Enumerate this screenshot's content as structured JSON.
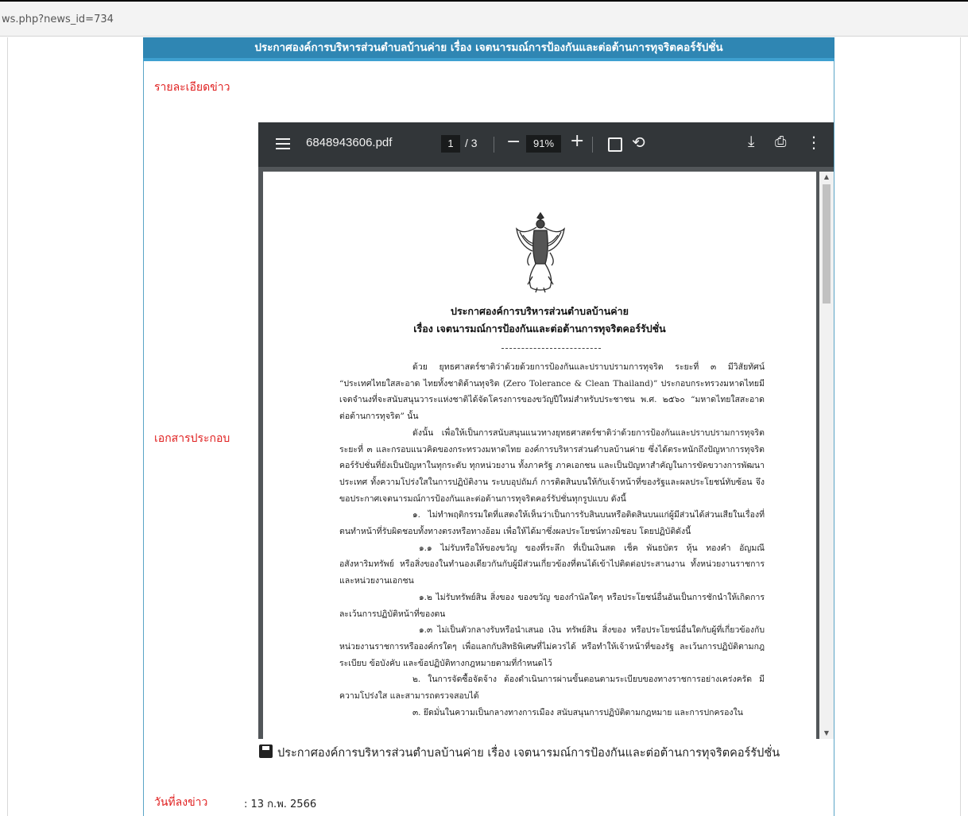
{
  "browser": {
    "url_fragment": "ws.php?news_id=734"
  },
  "news": {
    "header_title": "ประกาศองค์การบริหารส่วนตำบลบ้านค่าย เรื่อง เจตนารมณ์การป้องกันและต่อต้านการทุจริตคอร์รัปชั่น",
    "detail_label": "รายละเอียดข่าว",
    "attachment_label": "เอกสารประกอบ",
    "date_label": "วันที่ลงข่าว",
    "date_value": ": 13 ก.พ. 2566",
    "attachment_link": "ประกาศองค์การบริหารส่วนตำบลบ้านค่าย เรื่อง เจตนารมณ์การป้องกันและต่อต้านการทุจริตคอร์รัปชั่น"
  },
  "pdf_viewer": {
    "filename": "6848943606.pdf",
    "current_page": "1",
    "total_pages": "/ 3",
    "zoom": "91%",
    "minus_symbol": "−",
    "plus_symbol": "+",
    "icons": [
      "menu-icon",
      "fit-page-icon",
      "rotate-icon",
      "download-icon",
      "print-icon",
      "more-options-icon"
    ]
  },
  "document": {
    "title_line1": "ประกาศองค์การบริหารส่วนตำบลบ้านค่าย",
    "title_line2": "เรื่อง เจตนารมณ์การป้องกันและต่อต้านการทุจริตคอร์รัปชั่น",
    "paragraphs": [
      "ด้วย ยุทธศาสตร์ชาติว่าด้วยด้วยการป้องกันและปราบปรามการทุจริต ระยะที่ ๓ มีวิสัยทัศน์ “ประเทศไทยใสสะอาด ไทยทั้งชาติต้านทุจริต (Zero Tolerance & Clean Thailand)” ประกอบกระทรวงมหาดไทยมีเจตจำนงที่จะสนับสนุนวาระแห่งชาติได้จัดโครงการของขวัญปีใหม่สำหรับประชาชน พ.ศ. ๒๕๖๐ “มหาดไทยใสสะอาดต่อต้านการทุจริต” นั้น",
      "ดังนั้น เพื่อให้เป็นการสนับสนุนแนวทางยุทธศาสตร์ชาติว่าด้วยการป้องกันและปราบปรามการทุจริต ระยะที่ ๓ และกรอบแนวคิดของกระทรวงมหาดไทย องค์การบริหารส่วนตำบลบ้านค่าย ซึ่งได้ตระหนักถึงปัญหาการทุจริตคอร์รัปชั่นที่ยังเป็นปัญหาในทุกระดับ ทุกหน่วยงาน ทั้งภาครัฐ ภาคเอกชน และเป็นปัญหาสำคัญในการขัดขวางการพัฒนาประเทศ ทั้งความโปร่งใสในการปฏิบัติงาน ระบบอุปถัมภ์ การติดสินบนให้กับเจ้าหน้าที่ของรัฐและผลประโยชน์ทับซ้อน จึงขอประกาศเจตนารมณ์การป้องกันและต่อต้านการทุจริตคอร์รัปชั่นทุกรูปแบบ ดังนี้",
      "๑. ไม่ทำพฤติกรรมใดที่แสดงให้เห็นว่าเป็นการรับสินบนหรือติดสินบนแก่ผู้มีส่วนได้ส่วนเสียในเรื่องที่ตนทำหน้าที่รับผิดชอบทั้งทางตรงหรือทางอ้อม เพื่อให้ได้มาซึ่งผลประโยชน์ทางมิชอบ โดยปฏิบัติดังนี้",
      "๑.๑ ไม่รับหรือให้ของขวัญ ของที่ระลึก ที่เป็นเงินสด เช็ค พันธบัตร หุ้น ทองคำ อัญมณี อสังหาริมทรัพย์ หรือสิ่งของในทำนองเดียวกันกับผู้มีส่วนเกี่ยวข้องที่ตนได้เข้าไปติดต่อประสานงาน ทั้งหน่วยงานราชการและหน่วยงานเอกชน",
      "๑.๒ ไม่รับทรัพย์สิน สิ่งของ ของขวัญ ของกำนัลใดๆ หรือประโยชน์อื่นอันเป็นการชักนำให้เกิดการละเว้นการปฏิบัติหน้าที่ของตน",
      "๑.๓ ไม่เป็นตัวกลางรับหรือนำเสนอ เงิน ทรัพย์สิน สิ่งของ หรือประโยชน์อื่นใดกับผู้ที่เกี่ยวข้องกับหน่วยงานราชการหรือองค์กรใดๆ เพื่อแลกกับสิทธิพิเศษที่ไม่ควรได้ หรือทำให้เจ้าหน้าที่ของรัฐ ละเว้นการปฏิบัติตามกฎระเบียบ ข้อบังคับ และข้อปฏิบัติทางกฎหมายตามที่กำหนดไว้",
      "๒. ในการจัดซื้อจัดจ้าง ต้องดำเนินการผ่านขั้นตอนตามระเบียบของทางราชการอย่างเคร่งครัด มีความโปร่งใส และสามารถตรวจสอบได้",
      "๓. ยึดมั่นในความเป็นกลางทางการเมือง สนับสนุนการปฏิบัติตามกฎหมาย และการปกครองใน"
    ]
  }
}
